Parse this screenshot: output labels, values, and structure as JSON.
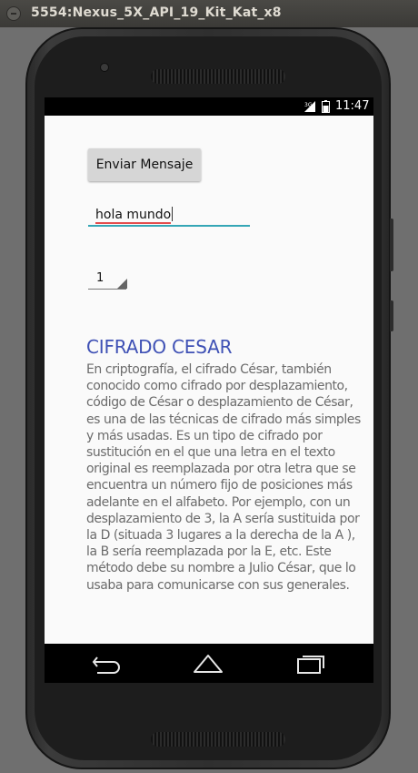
{
  "window": {
    "title": "5554:Nexus_5X_API_19_Kit_Kat_x8"
  },
  "status_bar": {
    "time": "11:47",
    "icons": [
      "signal-3g-icon",
      "battery-icon"
    ]
  },
  "app": {
    "send_button_label": "Enviar Mensaje",
    "message_input_value": "hola mundo",
    "spinner_value": "1",
    "heading": "CIFRADO CESAR",
    "description": "En criptografía, el cifrado César, también conocido como cifrado por desplazamiento, código de César o desplazamiento de César, es una de las técnicas de cifrado más simples y más usadas. Es un tipo de cifrado por sustitución en el que una letra en el texto original es reemplazada por otra letra que se encuentra un número fijo de posiciones más adelante en el alfabeto. Por ejemplo, con un desplazamiento de 3, la A sería sustituida por la D (situada 3 lugares a la derecha de la A ), la B sería reemplazada por la E, etc. Este método debe su nombre a Julio César, que lo usaba para comunicarse con sus generales."
  },
  "nav_bar": {
    "icons": [
      "back-icon",
      "home-icon",
      "recents-icon"
    ]
  },
  "colors": {
    "heading": "#3f51b5",
    "input_underline": "#35a6b6",
    "spellcheck_underline": "#e34c4c"
  }
}
